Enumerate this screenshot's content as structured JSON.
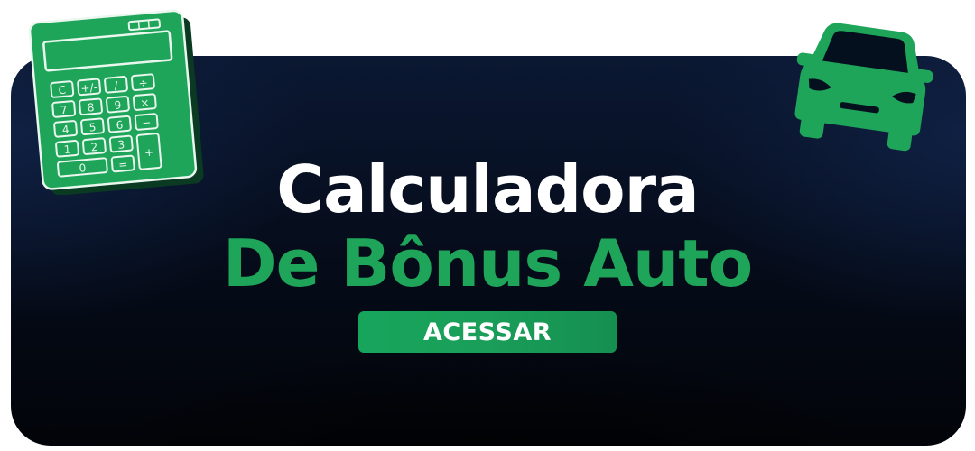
{
  "banner": {
    "title_line_1": "Calculadora",
    "title_line_2": "De Bônus Auto",
    "cta_label": "ACESSAR"
  },
  "icons": {
    "calculator": "calculator-icon",
    "car": "car-icon"
  },
  "colors": {
    "accent_green": "#1fa55a",
    "button_green": "#17a55c",
    "title_white": "#ffffff",
    "background_navy": "#0b1833",
    "background_black": "#020409"
  }
}
